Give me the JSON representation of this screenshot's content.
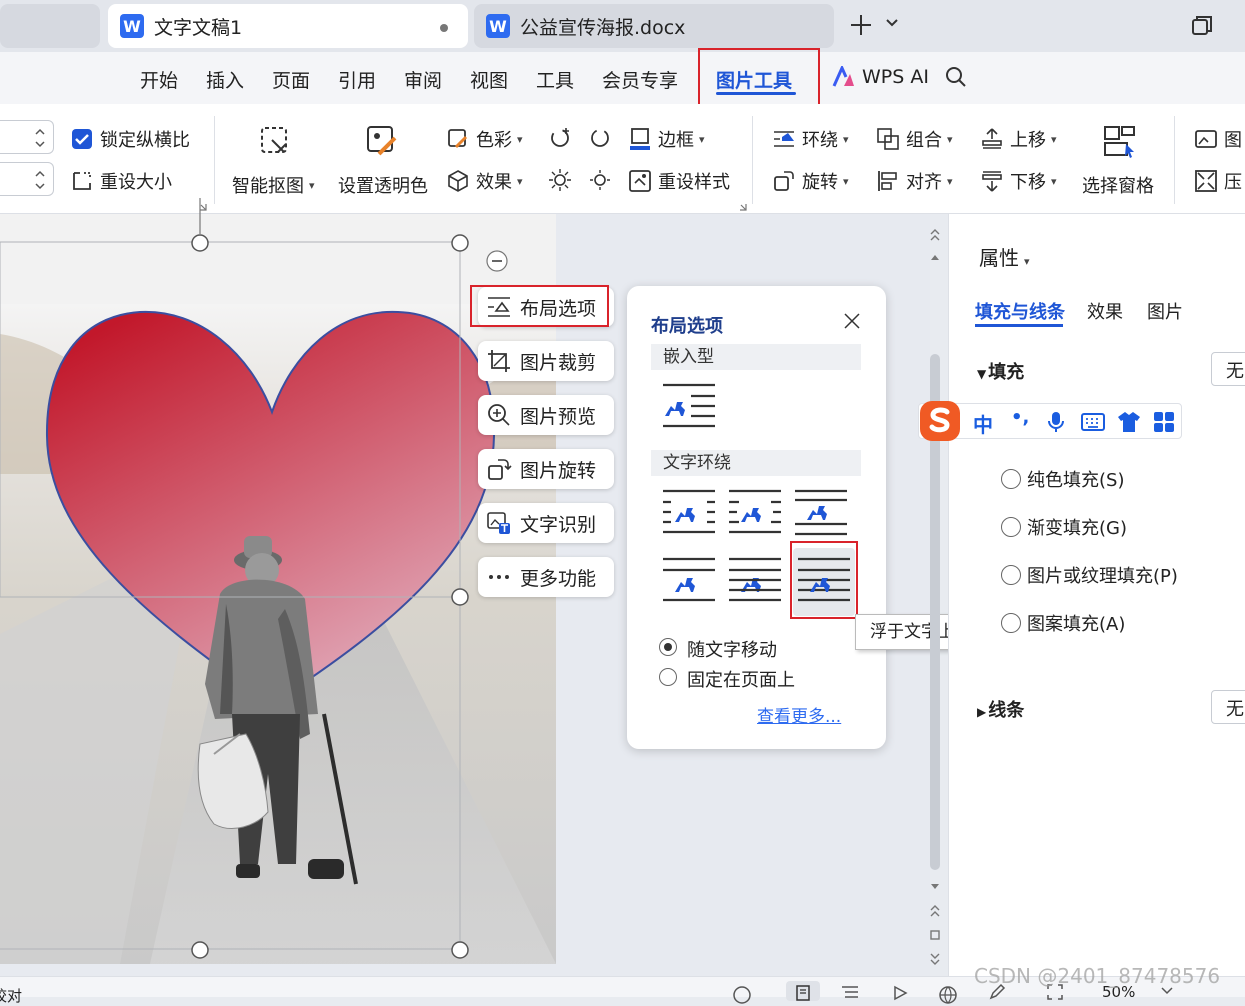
{
  "tabs": [
    {
      "label": "文字文稿1"
    },
    {
      "label": "公益宣传海报.docx"
    }
  ],
  "menu": [
    "开始",
    "插入",
    "页面",
    "引用",
    "审阅",
    "视图",
    "工具",
    "会员专享",
    "图片工具",
    "WPS AI"
  ],
  "ribbon": {
    "lock_ratio": "锁定纵横比",
    "reset_size": "重设大小",
    "smart_cutout": "智能抠图",
    "set_transparent": "设置透明色",
    "color": "色彩",
    "effect": "效果",
    "border": "边框",
    "reset_style": "重设样式",
    "wrap": "环绕",
    "group": "组合",
    "move_up": "上移",
    "rotate": "旋转",
    "align": "对齐",
    "move_down": "下移",
    "selection_pane": "选择窗格",
    "picture_partial": "图",
    "compress_partial": "压"
  },
  "float_toolbar": {
    "layout_options": "布局选项",
    "crop": "图片裁剪",
    "preview": "图片预览",
    "rotate": "图片旋转",
    "ocr": "文字识别",
    "more": "更多功能"
  },
  "popup": {
    "title": "布局选项",
    "inline_header": "嵌入型",
    "wrap_header": "文字环绕",
    "move_with_text": "随文字移动",
    "fix_on_page": "固定在页面上",
    "see_more": "查看更多...",
    "move_with_text_selected": true
  },
  "tooltip": "浮于文字上方",
  "panel": {
    "title": "属性",
    "tabs": [
      "填充与线条",
      "效果",
      "图片"
    ],
    "fill_header": "填充",
    "fill_value": "无",
    "options": [
      "纯色填充(S)",
      "渐变填充(G)",
      "图片或纹理填充(P)",
      "图案填充(A)"
    ],
    "line_header": "线条",
    "line_value": "无"
  },
  "ime": {
    "mode": "中",
    "punct": "•,"
  },
  "status": {
    "left": "校对",
    "zoom": "50%"
  },
  "watermark": "CSDN @2401_87478576",
  "colors": {
    "accent": "#1f56d6",
    "highlight": "#d9232b",
    "heart_top": "#c2182b",
    "heart_bottom": "#e3b4c4"
  },
  "icons": [
    "w-doc-icon",
    "plus-icon",
    "chevron-down-icon",
    "restore-window-icon",
    "search-icon",
    "wps-ai-icon",
    "checkbox-checked-icon",
    "close-icon",
    "sogou-ime-icon",
    "microphone-icon",
    "keyboard-icon",
    "shirt-icon",
    "grid-icon"
  ]
}
